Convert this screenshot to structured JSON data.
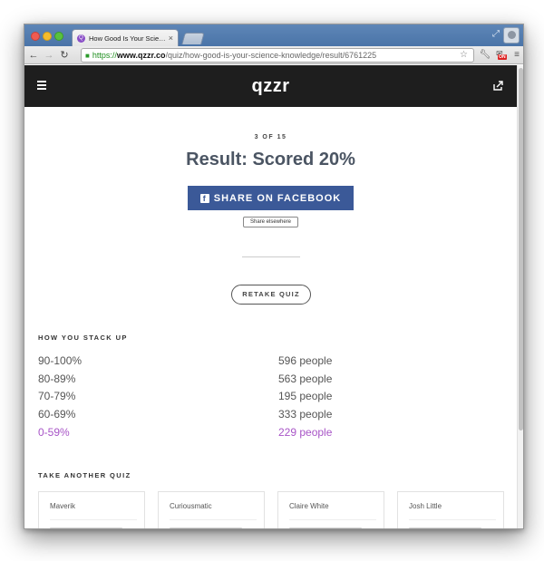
{
  "browser": {
    "tab_title": "How Good Is Your Science",
    "tab_favicon_letter": "Q",
    "url_scheme": "https://",
    "url_host": "www.qzzr.co",
    "url_path": "/quiz/how-good-is-your-science-knowledge/result/6761225",
    "extension_badge": "ON",
    "icons": [
      "back-icon",
      "forward-icon",
      "reload-icon",
      "lock-icon",
      "star-icon",
      "wrench-icon",
      "extension-icon",
      "menu-icon"
    ]
  },
  "site": {
    "logo": "qzzr",
    "header_bg": "#1e1e1e"
  },
  "result": {
    "counter": "3 OF 15",
    "title": "Result: Scored 20%",
    "share_facebook": "SHARE ON FACEBOOK",
    "facebook_icon_letter": "f",
    "share_elsewhere": "Share elsewhere",
    "retake": "RETAKE QUIZ",
    "facebook_color": "#3b5998"
  },
  "stack": {
    "title": "HOW YOU STACK UP",
    "highlight_color": "#a855c7",
    "rows": [
      {
        "range": "90-100%",
        "count": "596 people"
      },
      {
        "range": "80-89%",
        "count": "563 people"
      },
      {
        "range": "70-79%",
        "count": "195 people"
      },
      {
        "range": "60-69%",
        "count": "333 people"
      },
      {
        "range": "0-59%",
        "count": "229 people"
      }
    ]
  },
  "another": {
    "title": "TAKE ANOTHER QUIZ",
    "cards": [
      {
        "author": "Maverik"
      },
      {
        "author": "Curiousmatic"
      },
      {
        "author": "Claire White"
      },
      {
        "author": "Josh Little"
      }
    ]
  }
}
